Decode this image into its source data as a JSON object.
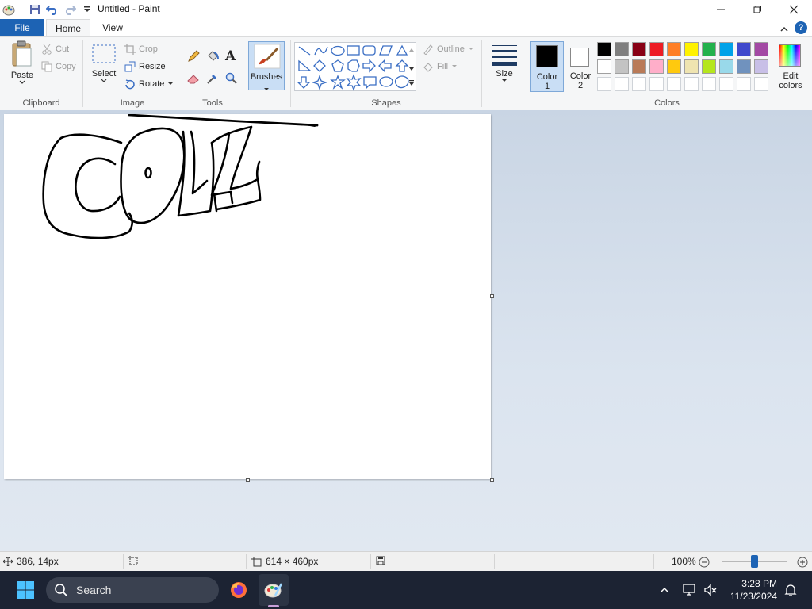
{
  "window": {
    "title": "Untitled - Paint"
  },
  "tabs": {
    "file": "File",
    "home": "Home",
    "view": "View"
  },
  "clipboard": {
    "paste": "Paste",
    "cut": "Cut",
    "copy": "Copy",
    "label": "Clipboard"
  },
  "image": {
    "select": "Select",
    "crop": "Crop",
    "resize": "Resize",
    "rotate": "Rotate",
    "label": "Image"
  },
  "tools": {
    "label": "Tools"
  },
  "brushes": {
    "label": "Brushes"
  },
  "shapes": {
    "outline": "Outline",
    "fill": "Fill",
    "label": "Shapes"
  },
  "size": {
    "label": "Size"
  },
  "color1": {
    "label": "Color",
    "num": "1",
    "value": "#000000"
  },
  "color2": {
    "label": "Color",
    "num": "2",
    "value": "#ffffff"
  },
  "colors": {
    "label": "Colors",
    "edit_label": "Edit",
    "edit_label2": "colors",
    "row1": [
      "#000000",
      "#7f7f7f",
      "#880015",
      "#ed1c24",
      "#ff7f27",
      "#fff200",
      "#22b14c",
      "#00a2e8",
      "#3f48cc",
      "#a349a4"
    ],
    "row2": [
      "#ffffff",
      "#c3c3c3",
      "#b97a57",
      "#ffaec9",
      "#ffc90e",
      "#efe4b0",
      "#b5e61d",
      "#99d9ea",
      "#7092be",
      "#c8bfe7"
    ]
  },
  "status": {
    "cursor": "386, 14px",
    "dimensions": "614 × 460px",
    "zoom": "100%",
    "zoom_level": 0.5
  },
  "taskbar": {
    "search": "Search",
    "time": "3:28 PM",
    "date": "11/23/2024"
  }
}
